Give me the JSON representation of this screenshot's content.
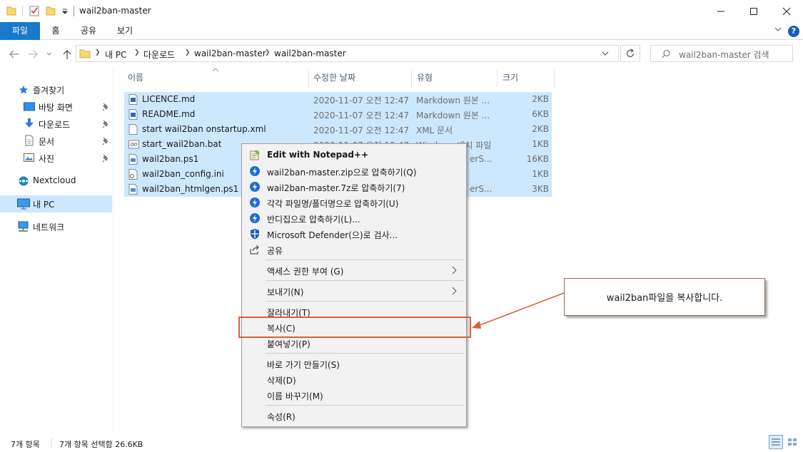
{
  "window": {
    "title": "wail2ban-master",
    "minimize_glyph": "─",
    "maximize_glyph": "☐",
    "close_glyph": "✕"
  },
  "ribbon": {
    "tabs": [
      "파일",
      "홈",
      "공유",
      "보기"
    ],
    "help_label": "?"
  },
  "navigation": {
    "breadcrumb": [
      "내 PC",
      "다운로드",
      "wail2ban-master",
      "wail2ban-master"
    ],
    "search_placeholder": "wail2ban-master 검색"
  },
  "sidebar": {
    "items": [
      {
        "label": "즐겨찾기",
        "icon": "star-icon"
      },
      {
        "label": "바탕 화면",
        "icon": "desktop-icon",
        "pinned": true
      },
      {
        "label": "다운로드",
        "icon": "download-icon",
        "pinned": true
      },
      {
        "label": "문서",
        "icon": "document-icon",
        "pinned": true
      },
      {
        "label": "사진",
        "icon": "pictures-icon",
        "pinned": true
      },
      {
        "label": "Nextcloud",
        "icon": "nextcloud-icon"
      },
      {
        "label": "내 PC",
        "icon": "pc-icon",
        "selected": true
      },
      {
        "label": "네트워크",
        "icon": "network-icon"
      }
    ]
  },
  "file_list": {
    "columns": [
      "이름",
      "수정한 날짜",
      "유형",
      "크기"
    ],
    "files": [
      {
        "name": "LICENCE.md",
        "date": "2020-11-07 오전 12:47",
        "type": "Markdown 원본 ...",
        "size": "2KB",
        "icon": "markdown-file-icon"
      },
      {
        "name": "README.md",
        "date": "2020-11-07 오전 12:47",
        "type": "Markdown 원본 ...",
        "size": "6KB",
        "icon": "markdown-file-icon"
      },
      {
        "name": "start wail2ban onstartup.xml",
        "date": "2020-11-07 오전 12:47",
        "type": "XML 문서",
        "size": "2KB",
        "icon": "xml-file-icon"
      },
      {
        "name": "start_wail2ban.bat",
        "date": "2020-11-07 오전 12:47",
        "type": "Windows 배치 파일",
        "size": "1KB",
        "icon": "batch-file-icon"
      },
      {
        "name": "wail2ban.ps1",
        "date": "",
        "type": "erS...",
        "size": "16KB",
        "icon": "powershell-file-icon"
      },
      {
        "name": "wail2ban_config.ini",
        "date": "",
        "type": "",
        "size": "1KB",
        "icon": "ini-file-icon"
      },
      {
        "name": "wail2ban_htmlgen.ps1",
        "date": "",
        "type": "erS...",
        "size": "3KB",
        "icon": "powershell-file-icon"
      }
    ]
  },
  "context_menu": {
    "items": [
      {
        "label": "Edit with Notepad++",
        "icon": "notepadpp-icon",
        "bold": true
      },
      {
        "label": "wail2ban-master.zip으로 압축하기(Q)",
        "icon": "bandizip-icon"
      },
      {
        "label": "wail2ban-master.7z로 압축하기(7)",
        "icon": "bandizip-icon"
      },
      {
        "label": "각각 파일명/폴더명으로 압축하기(U)",
        "icon": "bandizip-icon"
      },
      {
        "label": "반디집으로 압축하기(L)...",
        "icon": "bandizip-icon"
      },
      {
        "label": "Microsoft Defender(으)로 검사...",
        "icon": "defender-icon"
      },
      {
        "label": "공유",
        "icon": "share-icon"
      },
      {
        "label": "액세스 권한 부여 (G)",
        "submenu": true
      },
      {
        "label": "보내기(N)",
        "submenu": true
      },
      {
        "label": "잘라내기(T)"
      },
      {
        "label": "복사(C)"
      },
      {
        "label": "붙여넣기(P)"
      },
      {
        "label": "바로 가기 만들기(S)"
      },
      {
        "label": "삭제(D)"
      },
      {
        "label": "이름 바꾸기(M)"
      },
      {
        "label": "속성(R)"
      }
    ]
  },
  "annotation": {
    "callout_text": "wail2ban파일을 복사합니다.",
    "highlight_color": "#d6603a"
  },
  "status_bar": {
    "item_count": "7개 항목",
    "selection": "7개 항목 선택함 26.6KB"
  },
  "colors": {
    "ribbon_file_tab": "#1979ca",
    "selection": "#cce8ff",
    "menu_background": "#f2f2f2"
  }
}
